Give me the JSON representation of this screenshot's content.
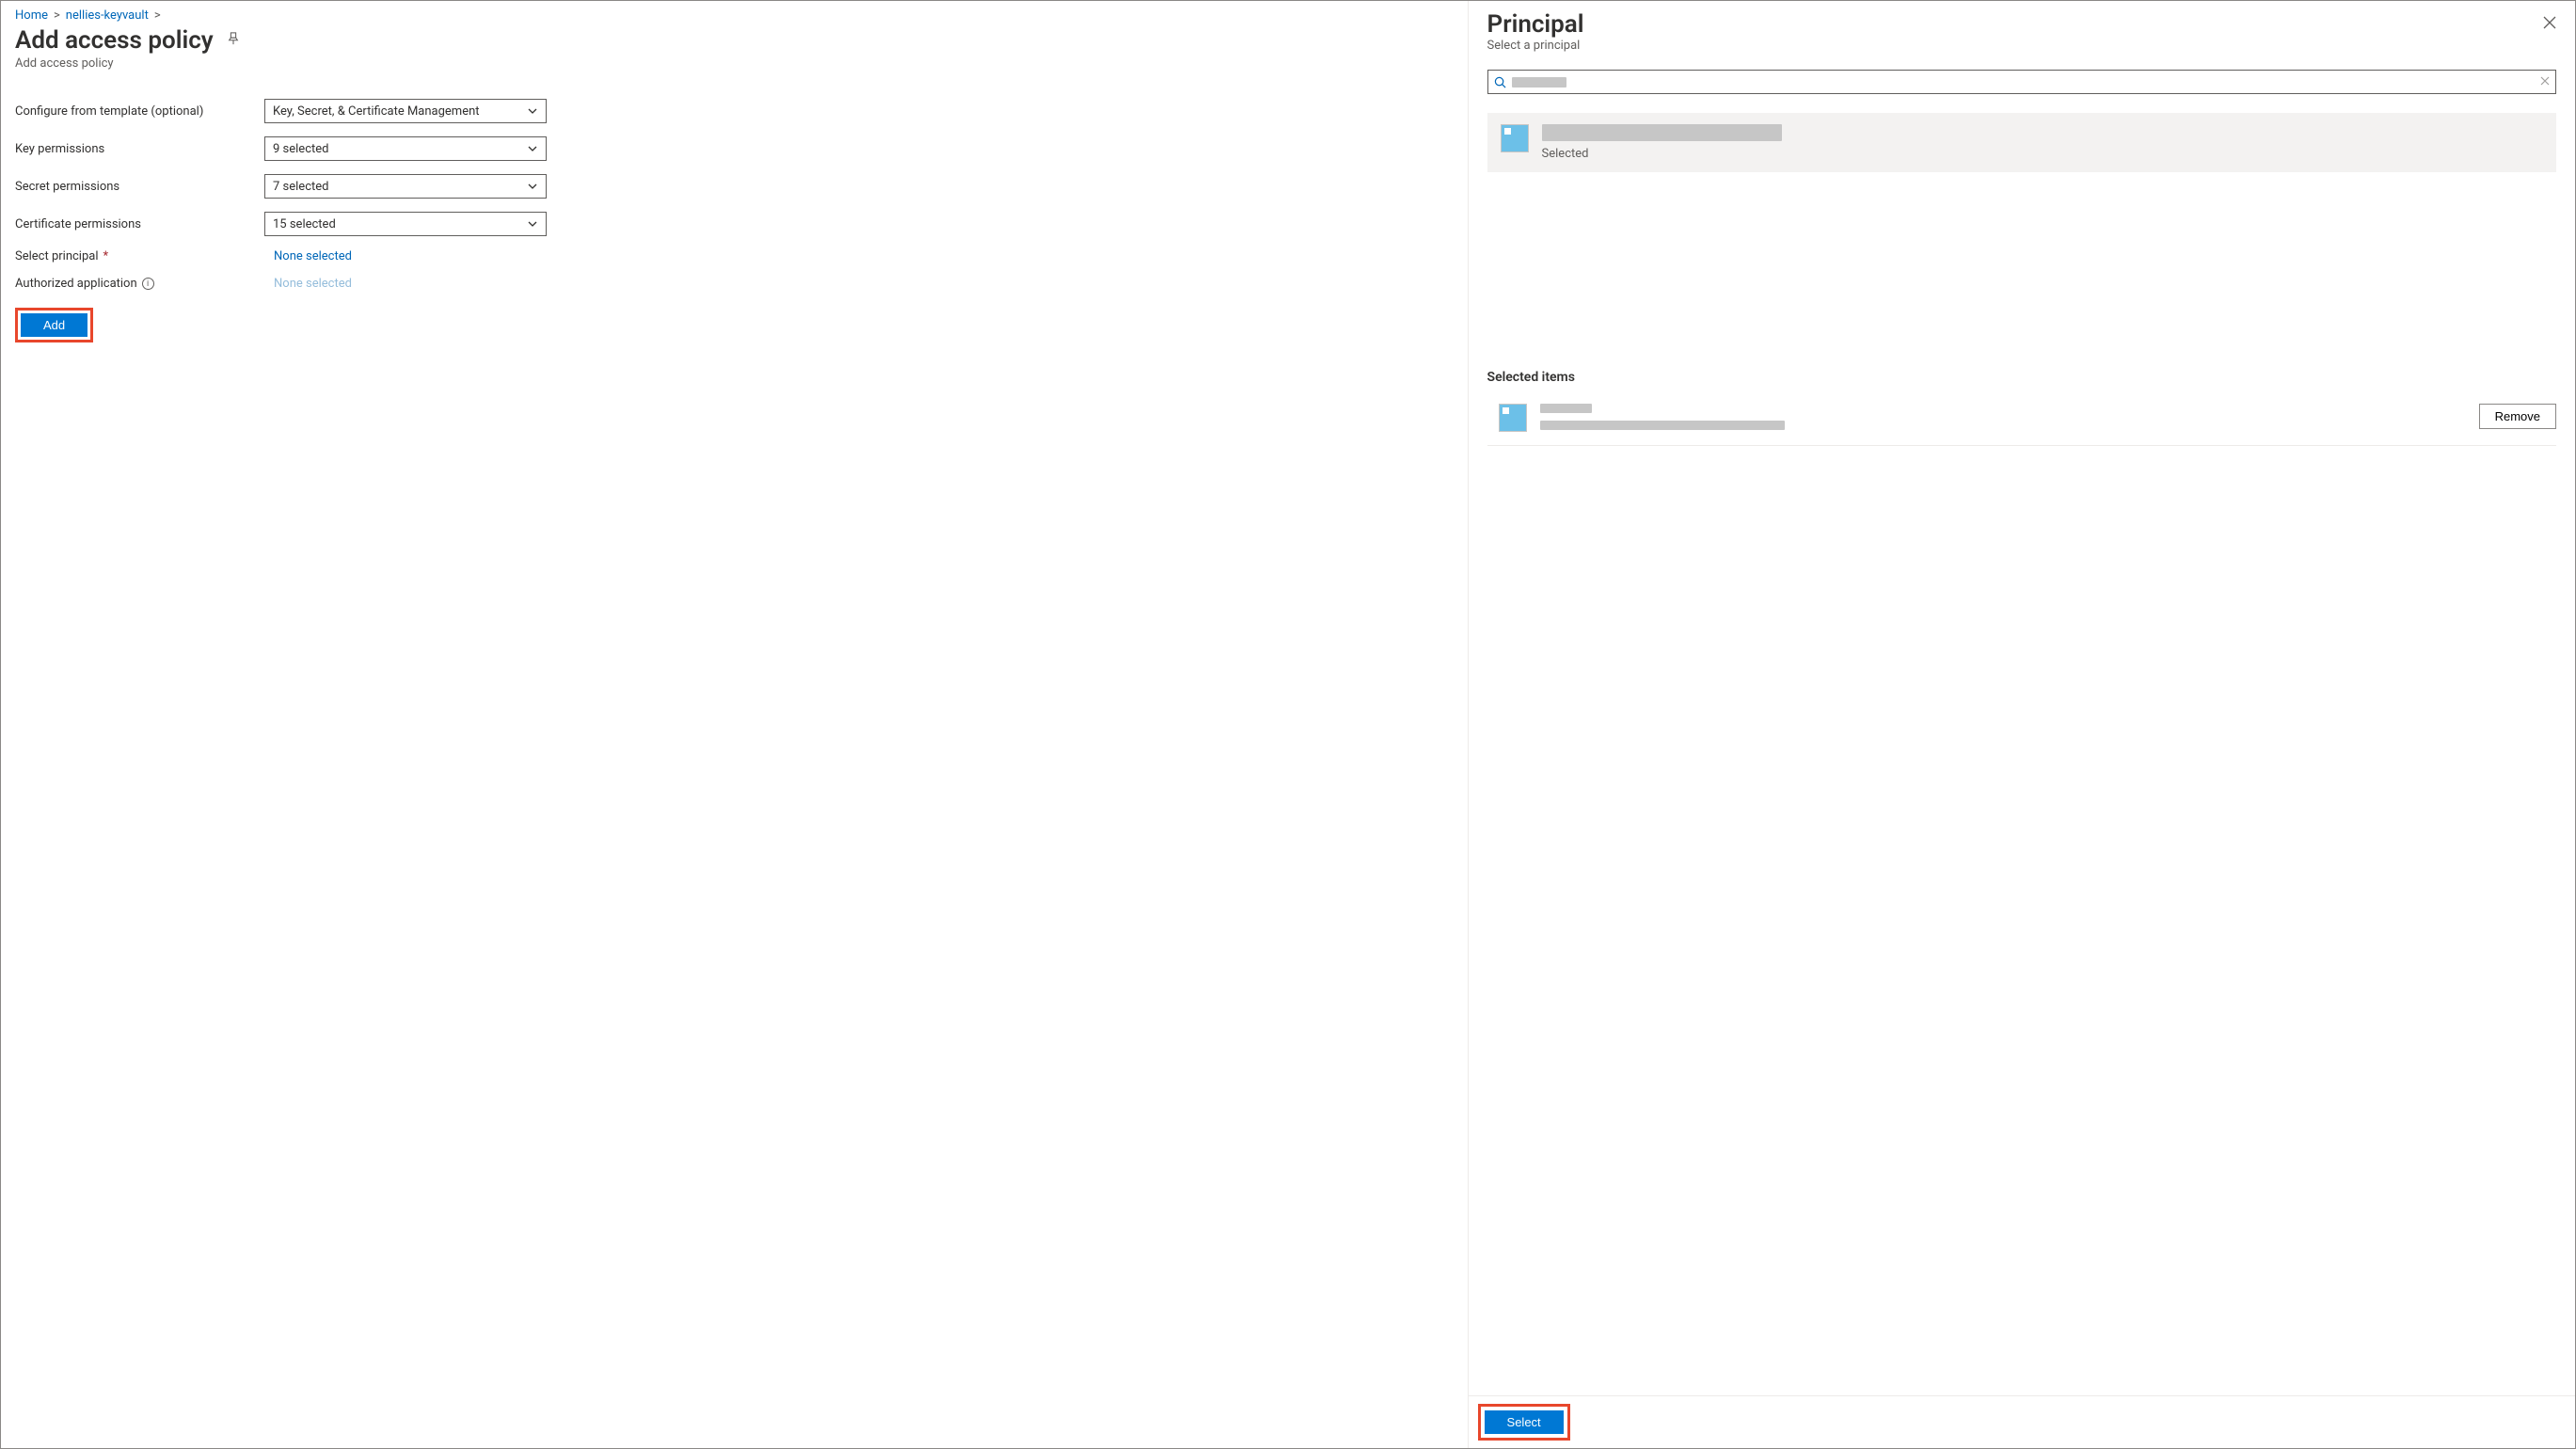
{
  "breadcrumb": {
    "home": "Home",
    "vault": "nellies-keyvault",
    "sep": ">"
  },
  "page": {
    "title": "Add access policy",
    "subtitle": "Add access policy"
  },
  "form": {
    "template_label": "Configure from template (optional)",
    "template_value": "Key, Secret, & Certificate Management",
    "key_label": "Key permissions",
    "key_value": "9 selected",
    "secret_label": "Secret permissions",
    "secret_value": "7 selected",
    "cert_label": "Certificate permissions",
    "cert_value": "15 selected",
    "principal_label": "Select principal",
    "principal_value": "None selected",
    "app_label": "Authorized application",
    "app_value": "None selected",
    "add_button": "Add"
  },
  "panel": {
    "title": "Principal",
    "subtitle": "Select a principal",
    "search_placeholder": "",
    "result_status": "Selected",
    "selected_heading": "Selected items",
    "remove_button": "Remove",
    "select_button": "Select"
  }
}
